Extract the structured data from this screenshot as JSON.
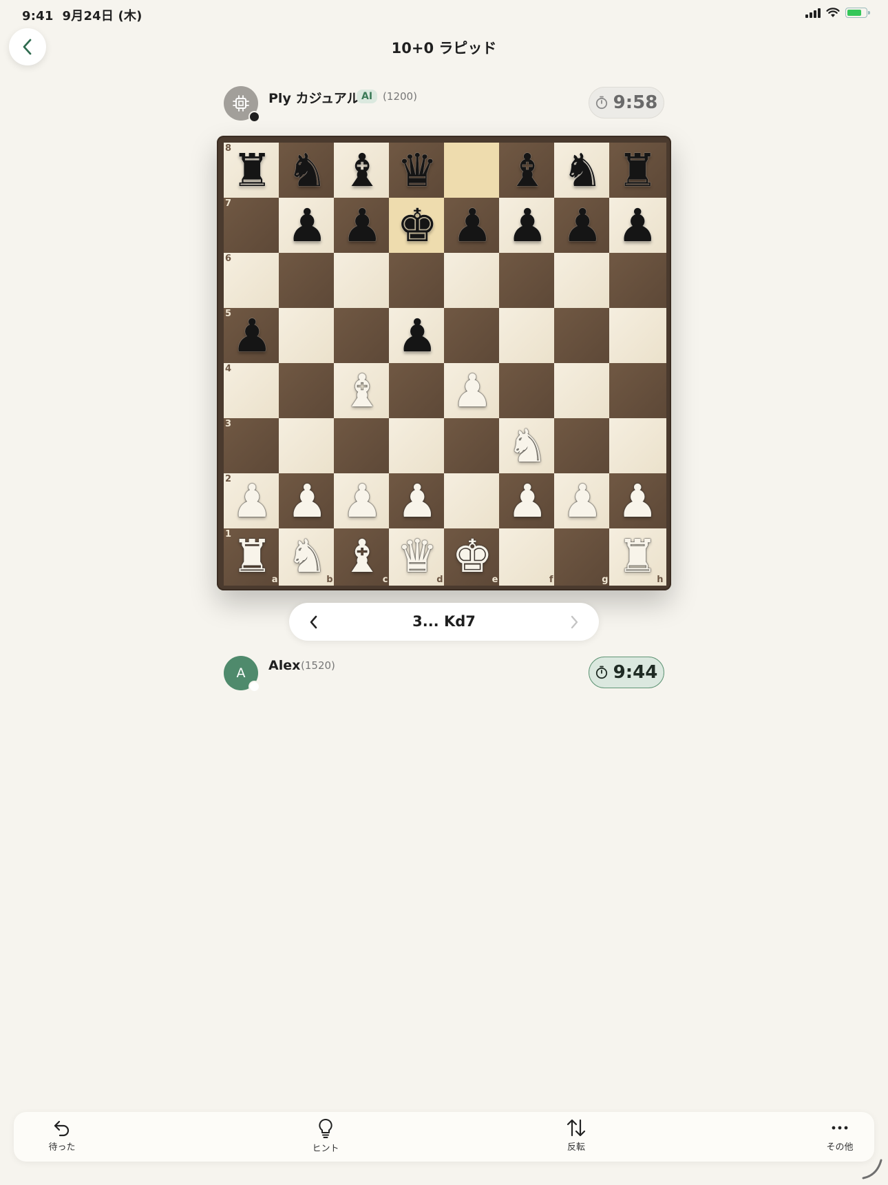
{
  "status_bar": {
    "time": "9:41",
    "date": "9月24日 (木)",
    "battery_level": 0.85
  },
  "header": {
    "title": "10+0 ラピッド"
  },
  "opponent": {
    "name": "Ply カジュアル",
    "badge": "AI",
    "rating": "(1200)",
    "clock": "9:58",
    "status_color": "#1f1f1f"
  },
  "player": {
    "name": "Alex",
    "initial": "A",
    "rating": "(1520)",
    "clock": "9:44",
    "status_color": "#ffffff"
  },
  "board": {
    "orientation": "white-bottom",
    "ranks": [
      "8",
      "7",
      "6",
      "5",
      "4",
      "3",
      "2",
      "1"
    ],
    "files": [
      "a",
      "b",
      "c",
      "d",
      "e",
      "f",
      "g",
      "h"
    ],
    "highlight": [
      "e8",
      "d7"
    ],
    "position": [
      [
        "r",
        "n",
        "b",
        "q",
        "",
        "b",
        "n",
        "r"
      ],
      [
        "",
        "p",
        "p",
        "k",
        "p",
        "p",
        "p",
        "p"
      ],
      [
        "",
        "",
        "",
        "",
        "",
        "",
        "",
        ""
      ],
      [
        "p",
        "",
        "",
        "p",
        "",
        "",
        "",
        ""
      ],
      [
        "",
        "",
        "B",
        "",
        "P",
        "",
        "",
        ""
      ],
      [
        "",
        "",
        "",
        "",
        "",
        "N",
        "",
        ""
      ],
      [
        "P",
        "P",
        "P",
        "P",
        "",
        "P",
        "P",
        "P"
      ],
      [
        "R",
        "N",
        "B",
        "Q",
        "K",
        "",
        "",
        "R"
      ]
    ],
    "colors": {
      "light": "#f2eadb",
      "dark": "#66503d",
      "highlight": "#eadaa9"
    }
  },
  "move_nav": {
    "current_move": "3... Kd7",
    "prev_icon": "chevron-left-icon",
    "next_icon": "chevron-right-icon"
  },
  "toolbar": {
    "undo": {
      "label": "待った",
      "icon": "undo-icon"
    },
    "hint": {
      "label": "ヒント",
      "icon": "lightbulb-icon"
    },
    "flip": {
      "label": "反転",
      "icon": "swap-vertical-icon"
    },
    "more": {
      "label": "その他",
      "icon": "more-horizontal-icon"
    }
  }
}
